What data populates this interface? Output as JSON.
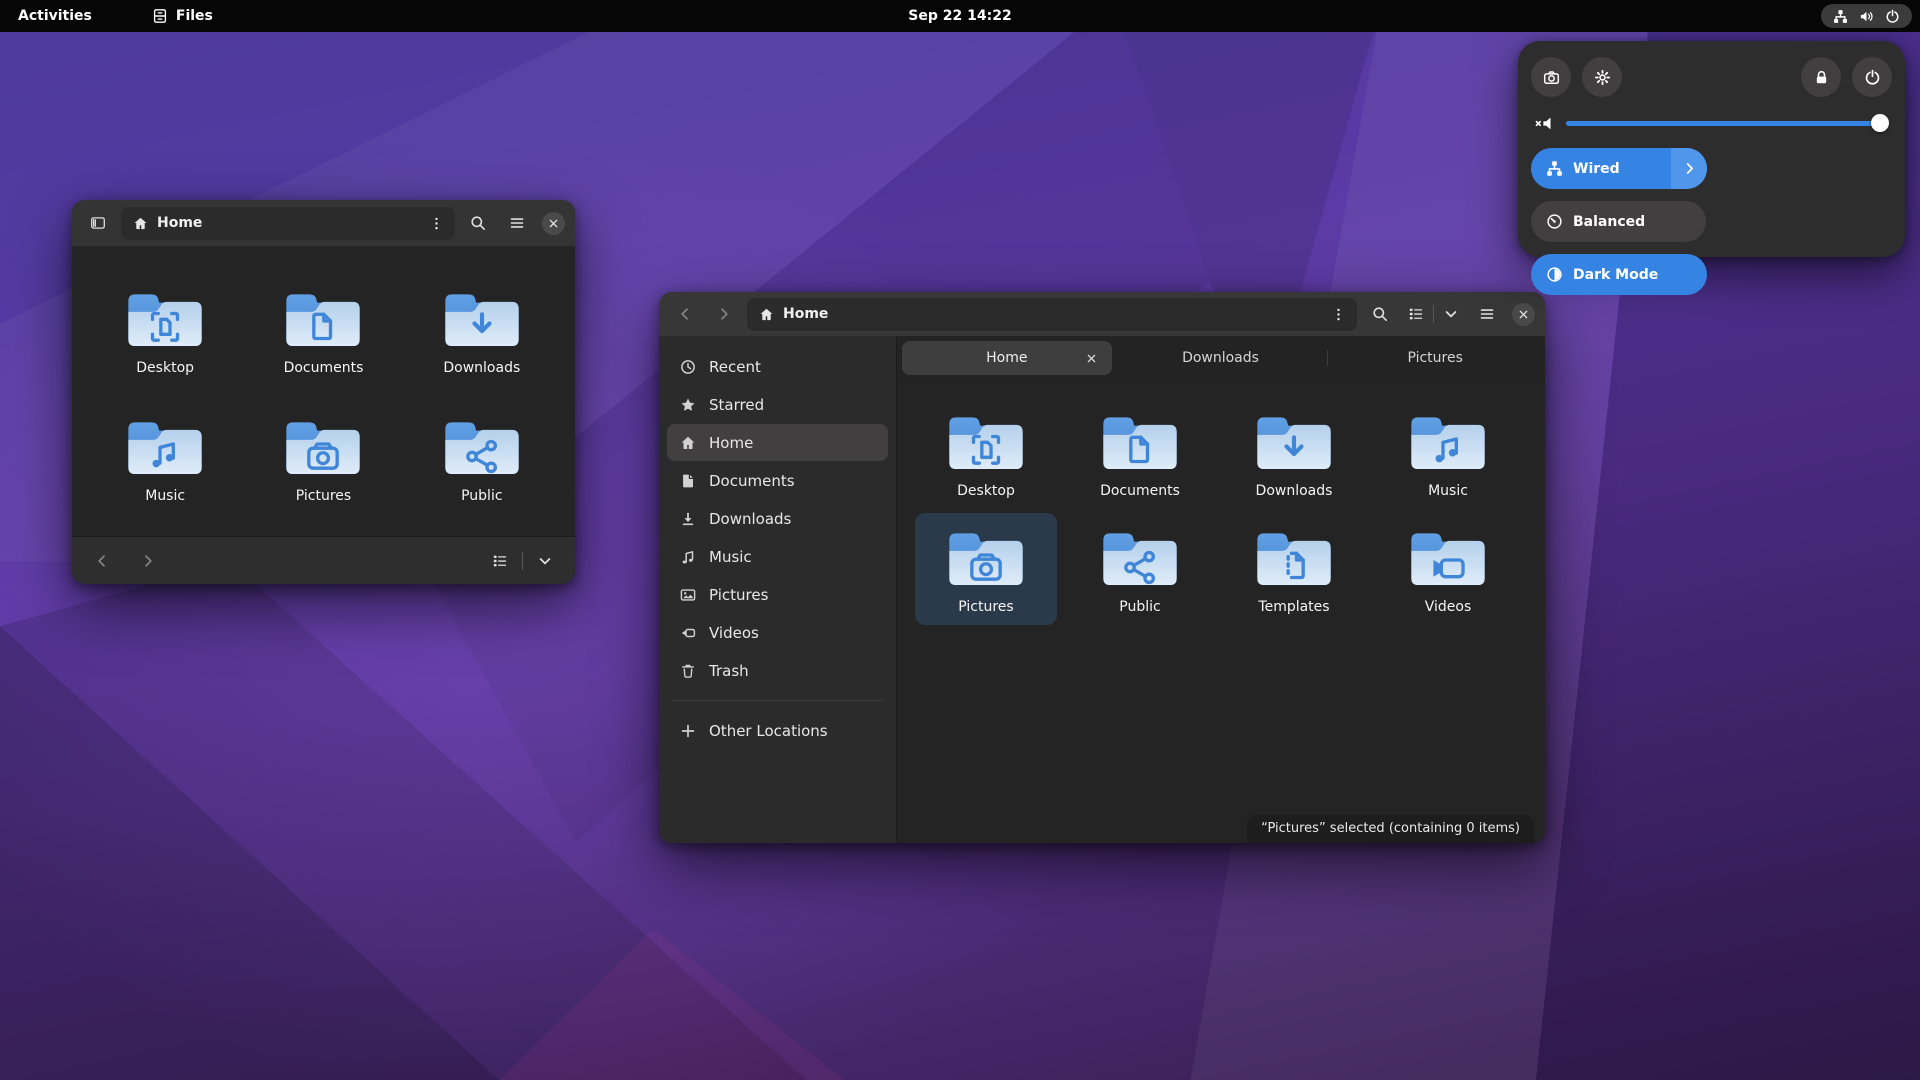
{
  "topbar": {
    "activities_label": "Activities",
    "app_menu_label": "Files",
    "clock": "Sep 22 14:22",
    "tray_icons": [
      "network-wired",
      "speaker",
      "power"
    ]
  },
  "quick_settings": {
    "buttons_left": [
      {
        "icon": "camera",
        "name": "screenshot-button"
      },
      {
        "icon": "settings",
        "name": "settings-button"
      }
    ],
    "buttons_right": [
      {
        "icon": "lock",
        "name": "lock-button"
      },
      {
        "icon": "power",
        "name": "power-button"
      }
    ],
    "volume": {
      "icon": "speaker-muted",
      "level_percent": 100
    },
    "toggles": [
      {
        "label": "Wired",
        "icon": "network-wired",
        "active": true,
        "expandable": true
      },
      {
        "label": "Balanced",
        "icon": "power-profile",
        "active": false,
        "expandable": false
      },
      {
        "label": "Dark Mode",
        "icon": "dark-mode",
        "active": true,
        "expandable": false
      }
    ]
  },
  "small_window": {
    "path": "Home",
    "folders": [
      {
        "name": "Desktop",
        "emblem": "desktop"
      },
      {
        "name": "Documents",
        "emblem": "documents"
      },
      {
        "name": "Downloads",
        "emblem": "downloads"
      },
      {
        "name": "Music",
        "emblem": "music"
      },
      {
        "name": "Pictures",
        "emblem": "pictures"
      },
      {
        "name": "Public",
        "emblem": "public"
      }
    ]
  },
  "big_window": {
    "path": "Home",
    "tabs": [
      {
        "label": "Home",
        "active": true,
        "closable": true
      },
      {
        "label": "Downloads",
        "active": false,
        "closable": false
      },
      {
        "label": "Pictures",
        "active": false,
        "closable": false
      }
    ],
    "sidebar": [
      {
        "label": "Recent",
        "icon": "recent"
      },
      {
        "label": "Starred",
        "icon": "starred"
      },
      {
        "label": "Home",
        "icon": "home",
        "selected": true
      },
      {
        "label": "Documents",
        "icon": "doc"
      },
      {
        "label": "Downloads",
        "icon": "download"
      },
      {
        "label": "Music",
        "icon": "music-note"
      },
      {
        "label": "Pictures",
        "icon": "image"
      },
      {
        "label": "Videos",
        "icon": "video"
      },
      {
        "label": "Trash",
        "icon": "trash"
      }
    ],
    "other_locations": {
      "label": "Other Locations",
      "icon": "plus"
    },
    "folders": [
      {
        "name": "Desktop",
        "emblem": "desktop"
      },
      {
        "name": "Documents",
        "emblem": "documents"
      },
      {
        "name": "Downloads",
        "emblem": "downloads"
      },
      {
        "name": "Music",
        "emblem": "music"
      },
      {
        "name": "Pictures",
        "emblem": "pictures",
        "selected": true
      },
      {
        "name": "Public",
        "emblem": "public"
      },
      {
        "name": "Templates",
        "emblem": "templates"
      },
      {
        "name": "Videos",
        "emblem": "videos"
      }
    ],
    "status": "“Pictures” selected (containing 0 items)"
  },
  "colors": {
    "accent": "#3584e4",
    "folder_emblem_blue": "#3f86d8",
    "selection_bg": "#2a3a4a",
    "wallpaper_purple": "#5b3a9e"
  },
  "icons_unicode": {
    "kebab": "⋮",
    "hamburger": "≡",
    "close": "✕",
    "search": "⌕",
    "chevron-left": "‹",
    "chevron-right": "›",
    "chevron-down": "▾",
    "plus": "+",
    "starred": "★",
    "dark-mode": "◐",
    "home": "⌂"
  }
}
